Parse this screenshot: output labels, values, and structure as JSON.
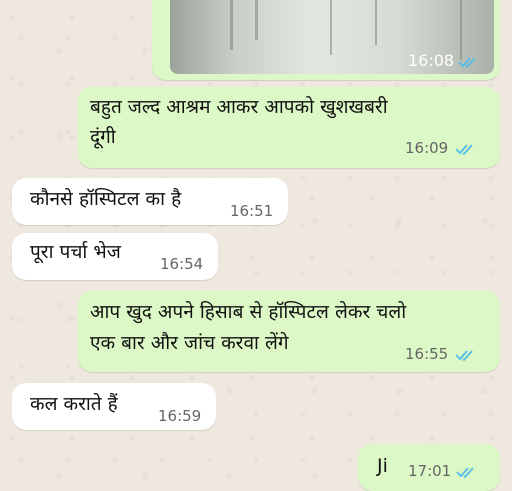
{
  "messages": [
    {
      "text_lines": [
        "बहुत जल्द आश्रम आकर आपको खुशखबरी",
        "दूंगी"
      ],
      "time": "16:09",
      "direction": "outgoing",
      "read": true
    },
    {
      "text_lines": [
        "कौनसे हॉस्पिटल का है"
      ],
      "time": "16:51",
      "direction": "incoming"
    },
    {
      "text_lines": [
        "पूरा पर्चा भेज"
      ],
      "time": "16:54",
      "direction": "incoming"
    },
    {
      "text_lines": [
        "आप खुद अपने हिसाब से हॉस्पिटल लेकर चलो",
        "एक बार और जांच करवा लेंगे"
      ],
      "time": "16:55",
      "direction": "outgoing",
      "read": true
    },
    {
      "text_lines": [
        "कल कराते हैं"
      ],
      "time": "16:59",
      "direction": "incoming"
    },
    {
      "text_lines": [
        "Ji"
      ],
      "time": "17:01",
      "direction": "outgoing",
      "read": true
    }
  ],
  "image_message": {
    "time": "16:08",
    "read": true,
    "read_color": "#53bdeb"
  },
  "colors": {
    "outgoing_bubble": "#dcf8c6",
    "incoming_bubble": "#ffffff",
    "read_tick": "#53bdeb"
  }
}
